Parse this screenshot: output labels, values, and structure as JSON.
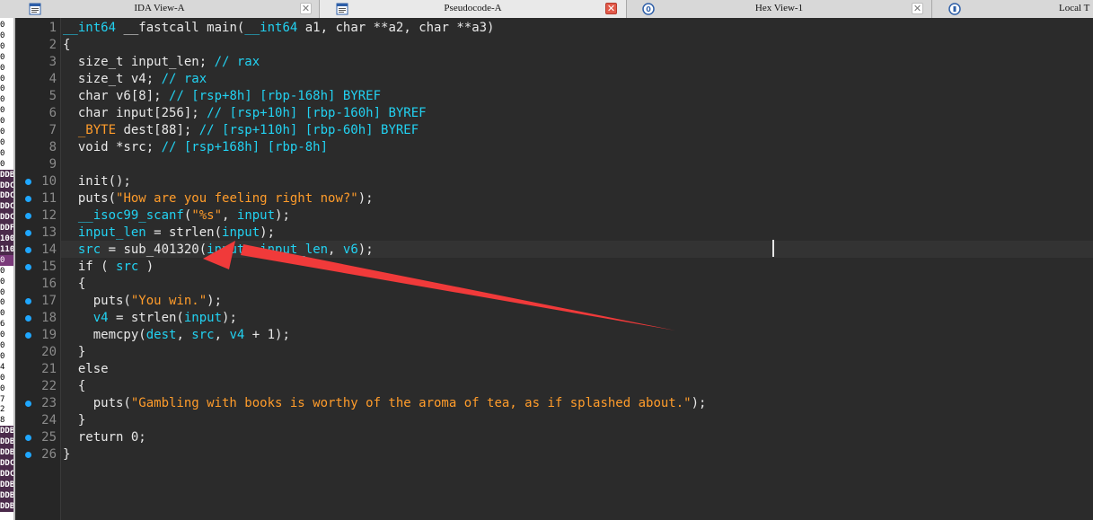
{
  "tabs": [
    {
      "label": "IDA View-A",
      "icon": "disassembly-icon",
      "state": "inactive"
    },
    {
      "label": "Pseudocode-A",
      "icon": "pseudocode-icon",
      "state": "active"
    },
    {
      "label": "Hex View-1",
      "icon": "hex-view-icon",
      "state": "inactive"
    },
    {
      "label": "Local T",
      "icon": "local-types-icon",
      "state": "inactive"
    }
  ],
  "close_glyph": "✕",
  "left_strip": [
    {
      "t": "0",
      "s": ""
    },
    {
      "t": "0",
      "s": ""
    },
    {
      "t": "0",
      "s": ""
    },
    {
      "t": "0",
      "s": ""
    },
    {
      "t": "0",
      "s": ""
    },
    {
      "t": "0",
      "s": ""
    },
    {
      "t": "0",
      "s": ""
    },
    {
      "t": "0",
      "s": ""
    },
    {
      "t": "0",
      "s": ""
    },
    {
      "t": "0",
      "s": ""
    },
    {
      "t": "0",
      "s": ""
    },
    {
      "t": "0",
      "s": ""
    },
    {
      "t": "0",
      "s": ""
    },
    {
      "t": "0",
      "s": ""
    },
    {
      "t": "DDB",
      "s": "hl"
    },
    {
      "t": "DDC",
      "s": "hl"
    },
    {
      "t": "DDC",
      "s": "hl"
    },
    {
      "t": "DDC",
      "s": "hl"
    },
    {
      "t": "DDC",
      "s": "hl"
    },
    {
      "t": "DDF",
      "s": "hl"
    },
    {
      "t": "100",
      "s": "hl"
    },
    {
      "t": "110",
      "s": "hl"
    },
    {
      "t": "0",
      "s": "sel"
    },
    {
      "t": "0",
      "s": ""
    },
    {
      "t": "0",
      "s": ""
    },
    {
      "t": "0",
      "s": ""
    },
    {
      "t": "0",
      "s": ""
    },
    {
      "t": "0",
      "s": ""
    },
    {
      "t": "6",
      "s": ""
    },
    {
      "t": "0",
      "s": ""
    },
    {
      "t": "0",
      "s": ""
    },
    {
      "t": "0",
      "s": ""
    },
    {
      "t": "4",
      "s": ""
    },
    {
      "t": "0",
      "s": ""
    },
    {
      "t": "0",
      "s": ""
    },
    {
      "t": "7",
      "s": ""
    },
    {
      "t": "2",
      "s": ""
    },
    {
      "t": "8",
      "s": ""
    },
    {
      "t": "DDB",
      "s": "hl"
    },
    {
      "t": "DDB",
      "s": "hl"
    },
    {
      "t": "DDB",
      "s": "hl"
    },
    {
      "t": "DDC",
      "s": "hl"
    },
    {
      "t": "DDC",
      "s": "hl"
    },
    {
      "t": "DDB",
      "s": "hl"
    },
    {
      "t": "DDB",
      "s": "hl"
    },
    {
      "t": "DDB",
      "s": "hl"
    }
  ],
  "colors": {
    "background": "#2b2b2b",
    "keyword": "#e8e8e8",
    "comment": "#22d2f2",
    "identifier": "#22d2f2",
    "string": "#ff9c2b",
    "breakpoint_dot": "#1fa7ff",
    "arrow": "#f03a3a"
  },
  "code": [
    {
      "n": "1",
      "dot": false,
      "tokens": [
        [
          "id",
          "__int64"
        ],
        [
          "kw",
          " __fastcall main("
        ],
        [
          "id",
          "__int64"
        ],
        [
          "kw",
          " a1, char **a2, char **a3)"
        ]
      ]
    },
    {
      "n": "2",
      "dot": false,
      "tokens": [
        [
          "kw",
          "{"
        ]
      ]
    },
    {
      "n": "3",
      "dot": false,
      "tokens": [
        [
          "kw",
          "  size_t input_len; "
        ],
        [
          "cm",
          "// rax"
        ]
      ]
    },
    {
      "n": "4",
      "dot": false,
      "tokens": [
        [
          "kw",
          "  size_t v4; "
        ],
        [
          "cm",
          "// rax"
        ]
      ]
    },
    {
      "n": "5",
      "dot": false,
      "tokens": [
        [
          "kw",
          "  char v6[8]; "
        ],
        [
          "cm",
          "// [rsp+8h] [rbp-168h] BYREF"
        ]
      ]
    },
    {
      "n": "6",
      "dot": false,
      "tokens": [
        [
          "kw",
          "  char input[256]; "
        ],
        [
          "cm",
          "// [rsp+10h] [rbp-160h] BYREF"
        ]
      ]
    },
    {
      "n": "7",
      "dot": false,
      "tokens": [
        [
          "kw",
          "  "
        ],
        [
          "st",
          "_BYTE"
        ],
        [
          "kw",
          " dest[88]; "
        ],
        [
          "cm",
          "// [rsp+110h] [rbp-60h] BYREF"
        ]
      ]
    },
    {
      "n": "8",
      "dot": false,
      "tokens": [
        [
          "kw",
          "  void *src; "
        ],
        [
          "cm",
          "// [rsp+168h] [rbp-8h]"
        ]
      ]
    },
    {
      "n": "9",
      "dot": false,
      "tokens": []
    },
    {
      "n": "10",
      "dot": true,
      "tokens": [
        [
          "kw",
          "  init();"
        ]
      ]
    },
    {
      "n": "11",
      "dot": true,
      "tokens": [
        [
          "kw",
          "  puts("
        ],
        [
          "st",
          "\"How are you feeling right now?\""
        ],
        [
          "kw",
          ");"
        ]
      ]
    },
    {
      "n": "12",
      "dot": true,
      "tokens": [
        [
          "kw",
          "  "
        ],
        [
          "id",
          "__isoc99_scanf"
        ],
        [
          "kw",
          "("
        ],
        [
          "st",
          "\"%s\""
        ],
        [
          "kw",
          ", "
        ],
        [
          "id",
          "input"
        ],
        [
          "kw",
          ");"
        ]
      ]
    },
    {
      "n": "13",
      "dot": true,
      "tokens": [
        [
          "kw",
          "  "
        ],
        [
          "id",
          "input_len"
        ],
        [
          "kw",
          " = strlen("
        ],
        [
          "id",
          "input"
        ],
        [
          "kw",
          ");"
        ]
      ]
    },
    {
      "n": "14",
      "dot": true,
      "tokens": [
        [
          "kw",
          "  "
        ],
        [
          "id",
          "src"
        ],
        [
          "kw",
          " = sub_401320("
        ],
        [
          "id",
          "input"
        ],
        [
          "kw",
          ", "
        ],
        [
          "id",
          "input_len"
        ],
        [
          "kw",
          ", "
        ],
        [
          "id",
          "v6"
        ],
        [
          "kw",
          ");"
        ]
      ]
    },
    {
      "n": "15",
      "dot": true,
      "tokens": [
        [
          "kw",
          "  if ( "
        ],
        [
          "id",
          "src"
        ],
        [
          "kw",
          " )"
        ]
      ]
    },
    {
      "n": "16",
      "dot": false,
      "tokens": [
        [
          "kw",
          "  {"
        ]
      ]
    },
    {
      "n": "17",
      "dot": true,
      "tokens": [
        [
          "kw",
          "    puts("
        ],
        [
          "st",
          "\"You win.\""
        ],
        [
          "kw",
          ");"
        ]
      ]
    },
    {
      "n": "18",
      "dot": true,
      "tokens": [
        [
          "kw",
          "    "
        ],
        [
          "id",
          "v4"
        ],
        [
          "kw",
          " = strlen("
        ],
        [
          "id",
          "input"
        ],
        [
          "kw",
          ");"
        ]
      ]
    },
    {
      "n": "19",
      "dot": true,
      "tokens": [
        [
          "kw",
          "    memcpy("
        ],
        [
          "id",
          "dest"
        ],
        [
          "kw",
          ", "
        ],
        [
          "id",
          "src"
        ],
        [
          "kw",
          ", "
        ],
        [
          "id",
          "v4"
        ],
        [
          "kw",
          " + 1);"
        ]
      ]
    },
    {
      "n": "20",
      "dot": false,
      "tokens": [
        [
          "kw",
          "  }"
        ]
      ]
    },
    {
      "n": "21",
      "dot": false,
      "tokens": [
        [
          "kw",
          "  else"
        ]
      ]
    },
    {
      "n": "22",
      "dot": false,
      "tokens": [
        [
          "kw",
          "  {"
        ]
      ]
    },
    {
      "n": "23",
      "dot": true,
      "tokens": [
        [
          "kw",
          "    puts("
        ],
        [
          "st",
          "\"Gambling with books is worthy of the aroma of tea, as if splashed about.\""
        ],
        [
          "kw",
          ");"
        ]
      ]
    },
    {
      "n": "24",
      "dot": false,
      "tokens": [
        [
          "kw",
          "  }"
        ]
      ]
    },
    {
      "n": "25",
      "dot": true,
      "tokens": [
        [
          "kw",
          "  return 0;"
        ]
      ]
    },
    {
      "n": "26",
      "dot": true,
      "tokens": [
        [
          "kw",
          "}"
        ]
      ]
    }
  ]
}
